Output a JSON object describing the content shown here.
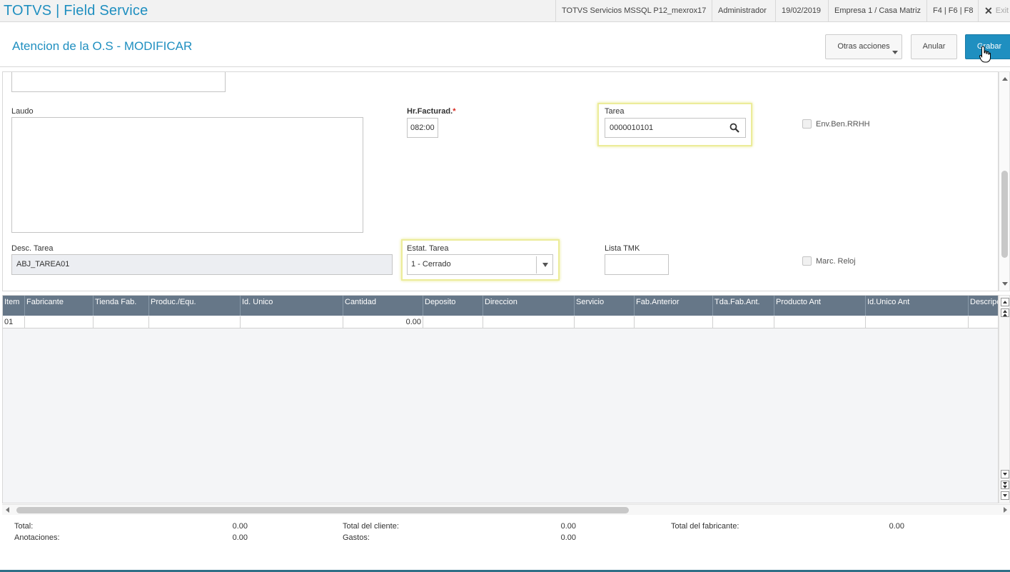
{
  "app": {
    "title": "TOTVS | Field Service",
    "environment": "TOTVS Servicios MSSQL P12_mexrox17",
    "user": "Administrador",
    "date": "19/02/2019",
    "company": "Empresa 1 / Casa Matriz",
    "shortcuts": "F4 | F6 | F8",
    "exit_label": "Exit"
  },
  "header": {
    "page_title": "Atencion de la O.S - MODIFICAR",
    "other_actions_label": "Otras acciones",
    "cancel_label": "Anular",
    "save_label": "Grabar"
  },
  "form": {
    "top_field_value": "",
    "laudo_label": "Laudo",
    "laudo_value": "",
    "hr_facturad_label": "Hr.Facturad.",
    "hr_facturad_required": "*",
    "hr_facturad_value": "082:00",
    "tarea_label": "Tarea",
    "tarea_value": "0000010101",
    "env_ben_label": "Env.Ben.RRHH",
    "desc_tarea_label": "Desc. Tarea",
    "desc_tarea_value": "ABJ_TAREA01",
    "estat_tarea_label": "Estat. Tarea",
    "estat_tarea_value": "1 - Cerrado",
    "lista_tmk_label": "Lista TMK",
    "lista_tmk_value": "",
    "marc_reloj_label": "Marc. Reloj"
  },
  "grid": {
    "columns": [
      "Item",
      "Fabricante",
      "Tienda Fab.",
      "Produc./Equ.",
      "Id. Unico",
      "Cantidad",
      "Deposito",
      "Direccion",
      "Servicio",
      "Fab.Anterior",
      "Tda.Fab.Ant.",
      "Producto Ant",
      "Id.Unico Ant",
      "Descripc"
    ],
    "rows": [
      {
        "item": "01",
        "fabricante": "",
        "tienda": "",
        "producto": "",
        "id_unico": "",
        "cantidad": "0.00",
        "deposito": "",
        "direccion": "",
        "servicio": "",
        "fab_anterior": "",
        "tda_fab_ant": "",
        "producto_ant": "",
        "id_unico_ant": "",
        "descripcion": ""
      }
    ]
  },
  "totals": {
    "total_label": "Total:",
    "total_value": "0.00",
    "anotaciones_label": "Anotaciones:",
    "anotaciones_value": "0.00",
    "total_cliente_label": "Total del cliente:",
    "total_cliente_value": "0.00",
    "gastos_label": "Gastos:",
    "gastos_value": "0.00",
    "total_fabricante_label": "Total del fabricante:",
    "total_fabricante_value": "0.00"
  },
  "colors": {
    "accent": "#1f8fc0",
    "grid_header": "#667788",
    "highlight": "#ecec9a"
  }
}
